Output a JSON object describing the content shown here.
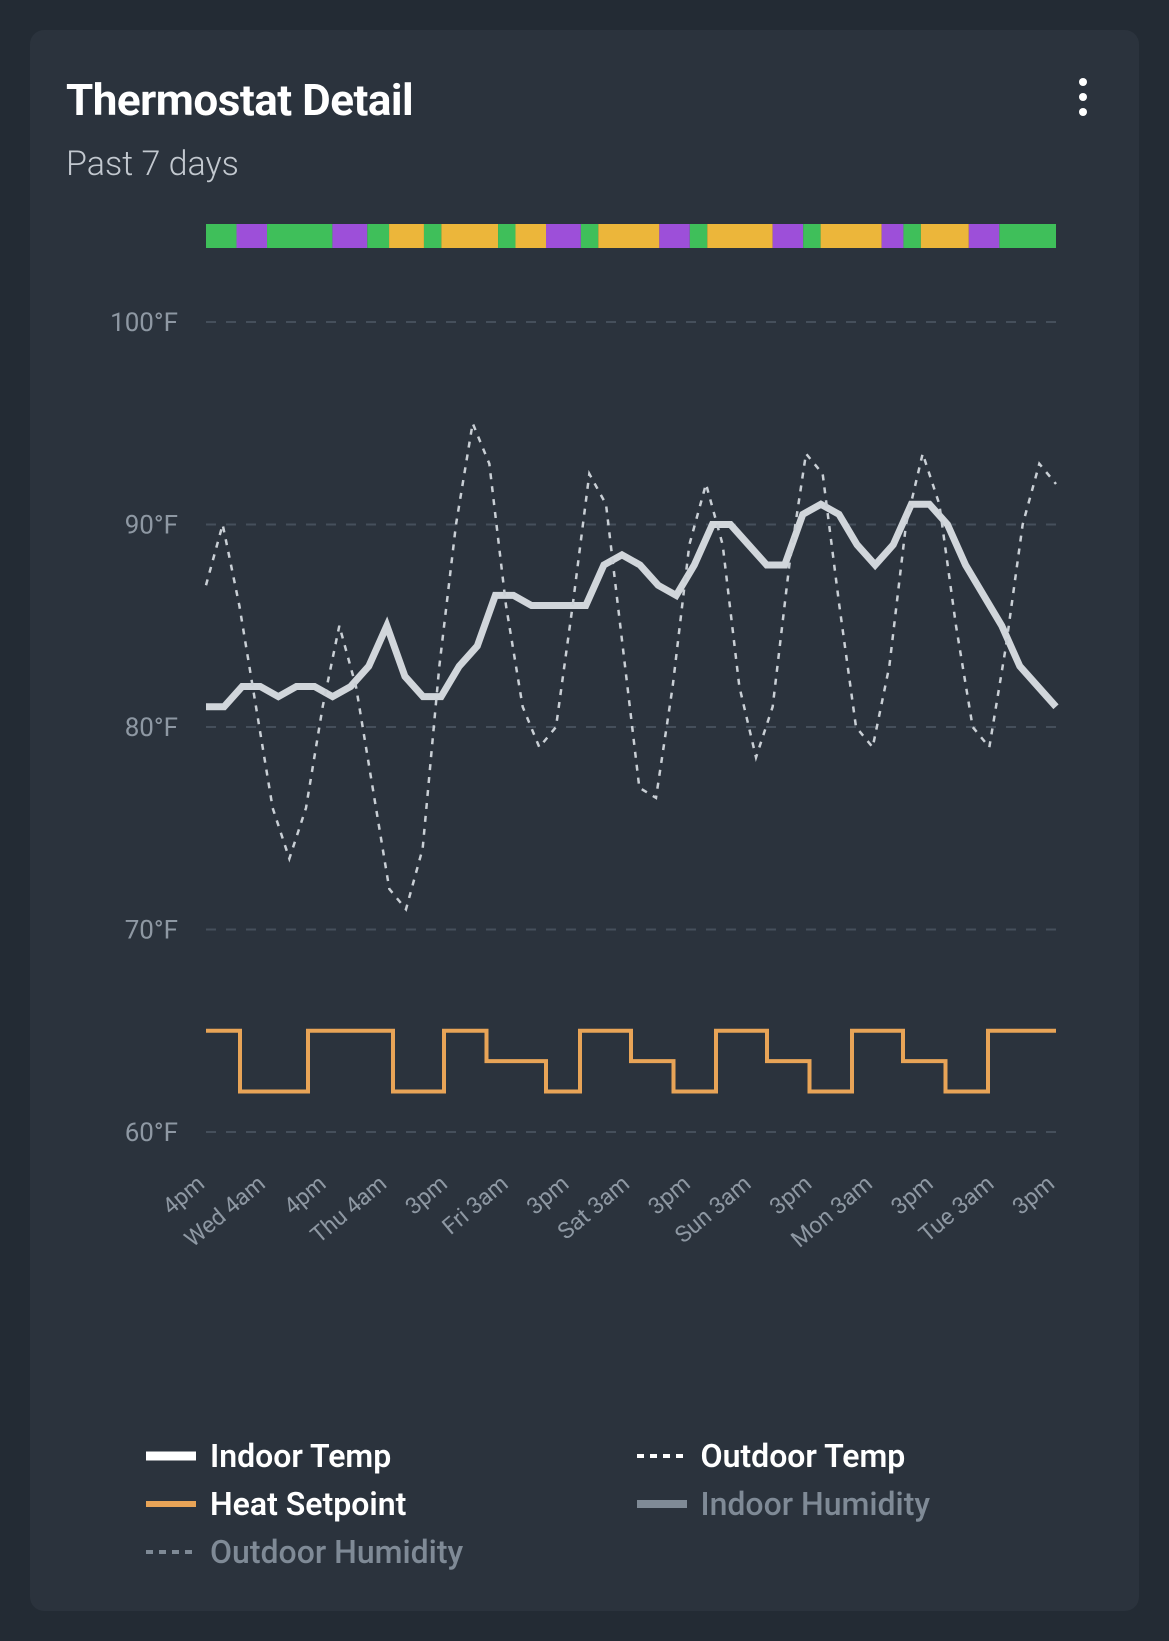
{
  "header": {
    "title": "Thermostat Detail",
    "subtitle": "Past 7 days"
  },
  "legend": {
    "indoor_temp": "Indoor Temp",
    "outdoor_temp": "Outdoor Temp",
    "heat_setpoint": "Heat Setpoint",
    "indoor_humidity": "Indoor Humidity",
    "outdoor_humidity": "Outdoor Humidity"
  },
  "colors": {
    "indoor_temp": "#d1d6db",
    "outdoor_temp": "#c9cfd5",
    "heat_setpoint": "#e8a457",
    "grid": "#454f5b",
    "bg": "#2b333d",
    "mode_green": "#3fbf5a",
    "mode_purple": "#9d4fd9",
    "mode_yellow": "#ecb63a"
  },
  "chart_data": {
    "type": "line",
    "ylabel": "°F",
    "ylim": [
      60,
      100
    ],
    "yticks": [
      60,
      70,
      80,
      90,
      100
    ],
    "ytick_labels": [
      "60°F",
      "70°F",
      "80°F",
      "90°F",
      "100°F"
    ],
    "x_categories": [
      "4pm",
      "Wed 4am",
      "4pm",
      "Thu 4am",
      "3pm",
      "Fri 3am",
      "3pm",
      "Sat 3am",
      "3pm",
      "Sun 3am",
      "3pm",
      "Mon 3am",
      "3pm",
      "Tue 3am",
      "3pm"
    ],
    "mode_bar": [
      {
        "mode": "green",
        "w": 3.5
      },
      {
        "mode": "purple",
        "w": 3.5
      },
      {
        "mode": "green",
        "w": 7.5
      },
      {
        "mode": "purple",
        "w": 4
      },
      {
        "mode": "green",
        "w": 2.5
      },
      {
        "mode": "yellow",
        "w": 4
      },
      {
        "mode": "green",
        "w": 2
      },
      {
        "mode": "yellow",
        "w": 6.5
      },
      {
        "mode": "green",
        "w": 2
      },
      {
        "mode": "yellow",
        "w": 3.5
      },
      {
        "mode": "purple",
        "w": 4
      },
      {
        "mode": "green",
        "w": 2
      },
      {
        "mode": "yellow",
        "w": 7
      },
      {
        "mode": "purple",
        "w": 3.5
      },
      {
        "mode": "green",
        "w": 2
      },
      {
        "mode": "yellow",
        "w": 7.5
      },
      {
        "mode": "purple",
        "w": 3.5
      },
      {
        "mode": "green",
        "w": 2
      },
      {
        "mode": "yellow",
        "w": 7
      },
      {
        "mode": "purple",
        "w": 2.5
      },
      {
        "mode": "green",
        "w": 2
      },
      {
        "mode": "yellow",
        "w": 5.5
      },
      {
        "mode": "purple",
        "w": 3.5
      },
      {
        "mode": "green",
        "w": 6.5
      }
    ],
    "series": [
      {
        "name": "Indoor Temp",
        "style": "solid_thick",
        "color": "#d1d6db",
        "values": [
          81,
          81,
          82,
          82,
          81.5,
          82,
          82,
          81.5,
          82,
          83,
          85,
          82.5,
          81.5,
          81.5,
          83,
          84,
          86.5,
          86.5,
          86,
          86,
          86,
          86,
          88,
          88.5,
          88,
          87,
          86.5,
          88,
          90,
          90,
          89,
          88,
          88,
          90.5,
          91,
          90.5,
          89,
          88,
          89,
          91,
          91,
          90,
          88,
          86.5,
          85,
          83,
          82,
          81
        ]
      },
      {
        "name": "Outdoor Temp",
        "style": "dashed_thin",
        "color": "#c9cfd5",
        "values": [
          87,
          90,
          86,
          81,
          76,
          73.5,
          76,
          81,
          85,
          82,
          77,
          72,
          71,
          74,
          83,
          90,
          95,
          93,
          86,
          81,
          79,
          80,
          86,
          92.5,
          91,
          84,
          77,
          76.5,
          82,
          89,
          92,
          89,
          82,
          78.5,
          81,
          88,
          93.5,
          92.5,
          86,
          80,
          79,
          83,
          90,
          93.5,
          91,
          85,
          80,
          79,
          84,
          90,
          93,
          92
        ]
      },
      {
        "name": "Heat Setpoint",
        "style": "solid_medium",
        "color": "#e8a457",
        "values_step": [
          {
            "x": 0,
            "y": 65
          },
          {
            "x": 4,
            "y": 65
          },
          {
            "x": 4,
            "y": 62
          },
          {
            "x": 12,
            "y": 62
          },
          {
            "x": 12,
            "y": 65
          },
          {
            "x": 22,
            "y": 65
          },
          {
            "x": 22,
            "y": 62
          },
          {
            "x": 28,
            "y": 62
          },
          {
            "x": 28,
            "y": 65
          },
          {
            "x": 33,
            "y": 65
          },
          {
            "x": 33,
            "y": 63.5
          },
          {
            "x": 40,
            "y": 63.5
          },
          {
            "x": 40,
            "y": 62
          },
          {
            "x": 44,
            "y": 62
          },
          {
            "x": 44,
            "y": 65
          },
          {
            "x": 50,
            "y": 65
          },
          {
            "x": 50,
            "y": 63.5
          },
          {
            "x": 55,
            "y": 63.5
          },
          {
            "x": 55,
            "y": 62
          },
          {
            "x": 60,
            "y": 62
          },
          {
            "x": 60,
            "y": 65
          },
          {
            "x": 66,
            "y": 65
          },
          {
            "x": 66,
            "y": 63.5
          },
          {
            "x": 71,
            "y": 63.5
          },
          {
            "x": 71,
            "y": 62
          },
          {
            "x": 76,
            "y": 62
          },
          {
            "x": 76,
            "y": 65
          },
          {
            "x": 82,
            "y": 65
          },
          {
            "x": 82,
            "y": 63.5
          },
          {
            "x": 87,
            "y": 63.5
          },
          {
            "x": 87,
            "y": 62
          },
          {
            "x": 92,
            "y": 62
          },
          {
            "x": 92,
            "y": 65
          },
          {
            "x": 100,
            "y": 65
          }
        ]
      }
    ]
  }
}
